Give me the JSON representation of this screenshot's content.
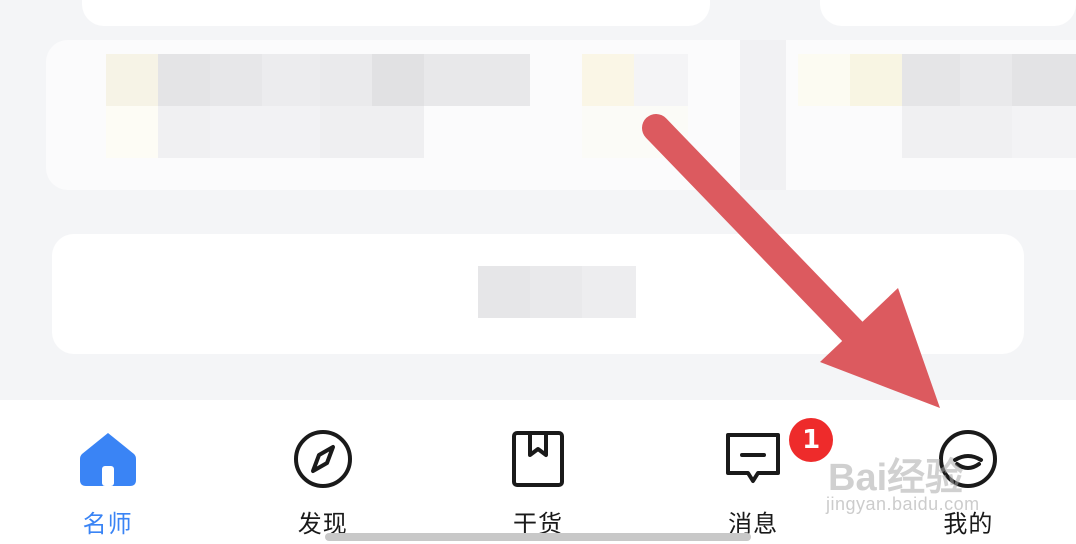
{
  "tabbar": {
    "tabs": [
      {
        "id": "home",
        "label": "名师",
        "icon": "home-icon",
        "active": true
      },
      {
        "id": "discover",
        "label": "发现",
        "icon": "compass-icon",
        "active": false
      },
      {
        "id": "goods",
        "label": "干货",
        "icon": "bookmark-icon",
        "active": false
      },
      {
        "id": "messages",
        "label": "消息",
        "icon": "message-icon",
        "active": false,
        "badge": "1"
      },
      {
        "id": "mine",
        "label": "我的",
        "icon": "profile-icon",
        "active": false
      }
    ]
  },
  "watermark": {
    "brand": "Bai经验",
    "url": "jingyan.baidu.com"
  },
  "colors": {
    "accent": "#3a84f5",
    "badge": "#ee2b2b",
    "arrow": "#dc5a5f"
  }
}
